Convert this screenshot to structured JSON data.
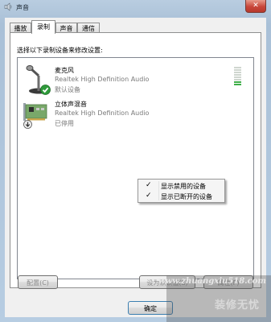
{
  "window": {
    "title": "声音",
    "close_glyph": "✕"
  },
  "tabs": [
    {
      "label": "播放",
      "active": false
    },
    {
      "label": "录制",
      "active": true
    },
    {
      "label": "声音",
      "active": false
    },
    {
      "label": "通信",
      "active": false
    }
  ],
  "instruction": "选择以下录制设备来修改设置:",
  "devices": [
    {
      "name": "麦克风",
      "driver": "Realtek High Definition Audio",
      "status": "默认设备",
      "icon": "microphone-icon",
      "badge": "default-check-icon",
      "level_fraction": 0.25
    },
    {
      "name": "立体声混音",
      "driver": "Realtek High Definition Audio",
      "status": "已停用",
      "icon": "sound-card-icon",
      "badge": "disabled-down-arrow-icon"
    }
  ],
  "context_menu": {
    "items": [
      {
        "label": "显示禁用的设备",
        "checked": true,
        "check_glyph": "✓"
      },
      {
        "label": "显示已断开的设备",
        "checked": true,
        "check_glyph": "✓"
      }
    ]
  },
  "buttons": {
    "configure": "配置(C)",
    "set_default": "设为默认值(S)",
    "properties": "属性(P)",
    "ok": "确定"
  },
  "watermark": {
    "url": "www.zhuangxiu518.com",
    "name": "装修无忧"
  },
  "colors": {
    "level_on": "#3fae49",
    "close_button": "#c8473a",
    "check_badge": "#2e9a3a"
  }
}
